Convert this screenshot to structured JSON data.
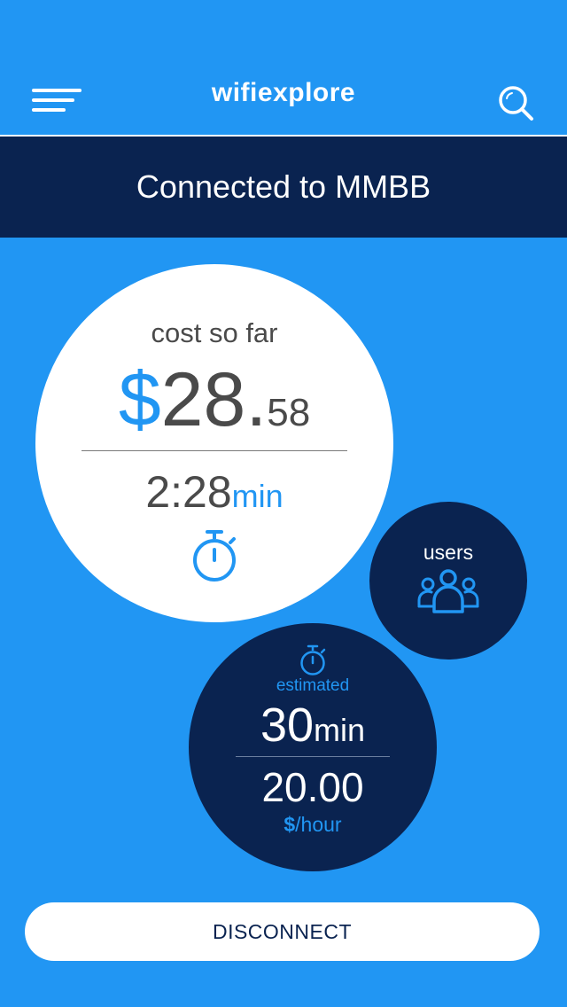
{
  "header": {
    "app_title": "wifiexplore",
    "menu_icon": "hamburger-menu-icon",
    "search_icon": "search-icon"
  },
  "status": {
    "text": "Connected to MMBB"
  },
  "cost": {
    "label": "cost so far",
    "currency": "$",
    "whole": "28.",
    "cents": "58",
    "elapsed_value": "2:28",
    "elapsed_unit": "min",
    "icon": "stopwatch-icon"
  },
  "users": {
    "label": "users",
    "icon": "users-group-icon"
  },
  "estimate": {
    "icon": "stopwatch-icon",
    "label": "estimated",
    "duration_value": "30",
    "duration_unit": "min",
    "rate_value": "20.00",
    "rate_unit_currency": "$",
    "rate_unit_time": "/hour"
  },
  "actions": {
    "disconnect_label": "DISCONNECT"
  },
  "colors": {
    "background": "#2196F3",
    "navy": "#0A2350",
    "accent": "#2196F3",
    "text_dark": "#4a4a4a",
    "white": "#ffffff"
  }
}
